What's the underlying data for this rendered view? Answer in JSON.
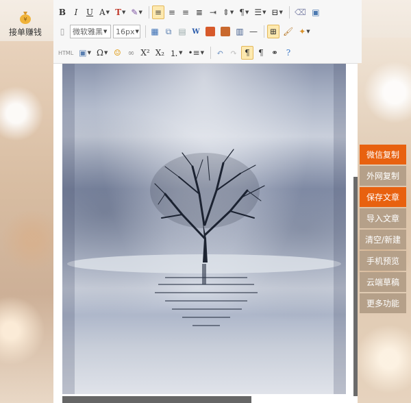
{
  "logo": {
    "text": "接单赚钱",
    "icon": "money-bag-icon"
  },
  "toolbar": {
    "font_family_value": "微软雅黑",
    "font_size_value": "16px",
    "bold": "B",
    "italic": "I",
    "underline": "U",
    "font_color": "A",
    "omega": "Ω",
    "superscript": "X²",
    "subscript": "X₂",
    "html_label": "HTML"
  },
  "side_menu": {
    "items": [
      {
        "label": "微信复制",
        "highlight": true
      },
      {
        "label": "外网复制",
        "highlight": false
      },
      {
        "label": "保存文章",
        "highlight": true
      },
      {
        "label": "导入文章",
        "highlight": false
      },
      {
        "label": "清空/新建",
        "highlight": false
      },
      {
        "label": "手机预览",
        "highlight": false
      },
      {
        "label": "云端草稿",
        "highlight": false
      },
      {
        "label": "更多功能",
        "highlight": false
      }
    ]
  },
  "colors": {
    "accent": "#e8610f",
    "side_default": "#b5a089"
  }
}
